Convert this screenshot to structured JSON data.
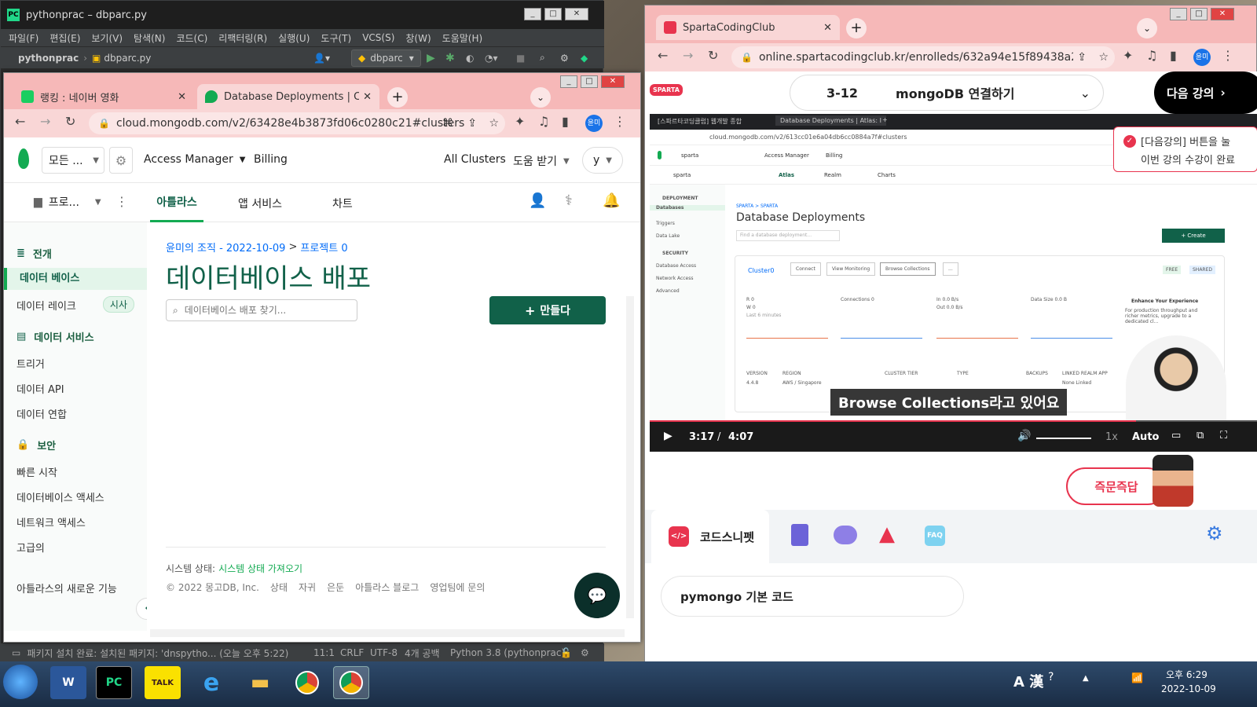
{
  "pycharm": {
    "title": "pythonprac – dbparc.py",
    "menu": [
      "파일(F)",
      "편집(E)",
      "보기(V)",
      "탐색(N)",
      "코드(C)",
      "리팩터링(R)",
      "실행(U)",
      "도구(T)",
      "VCS(S)",
      "창(W)",
      "도움말(H)"
    ],
    "project": "pythonprac",
    "file": "dbparc.py",
    "run_config": "dbparc",
    "status_message": "패키지 설치 완료: 설치된 패키지: 'dnspytho... (오늘 오후 5:22)",
    "status_right": [
      "11:1",
      "CRLF",
      "UTF-8",
      "4개 공백",
      "Python 3.8 (pythonprac)"
    ]
  },
  "chrome_left": {
    "tab1": "랭킹 : 네이버 영화",
    "tab2": "Database Deployments | Cloud",
    "url": "cloud.mongodb.com/v2/63428e4b3873fd06c0280c21#clusters",
    "profile": "윤미"
  },
  "atlas": {
    "org": "모든 ...",
    "access_manager": "Access Manager",
    "billing": "Billing",
    "all_clusters": "All Clusters",
    "help": "도움 받기",
    "user": "y",
    "project": "프로...",
    "tabs": {
      "atlas": "아틀라스",
      "app_services": "앱 서비스",
      "charts": "차트"
    },
    "side": {
      "deployment": "전개",
      "databases": "데이터 베이스",
      "data_lake": "데이터 레이크",
      "preview": "시사",
      "data_services": "데이터 서비스",
      "triggers": "트리거",
      "data_api": "데이터 API",
      "data_federation": "데이터 연합",
      "security": "보안",
      "quickstart": "빠른 시작",
      "db_access": "데이터베이스 액세스",
      "network_access": "네트워크 액세스",
      "advanced": "고급의",
      "whats_new": "아틀라스의 새로운 기능"
    },
    "breadcrumb_org": "윤미의 조직 - 2022-10-09",
    "breadcrumb_sep": ">",
    "breadcrumb_project": "프로젝트 0",
    "page_title": "데이터베이스 배포",
    "search_placeholder": "데이터베이스 배포 찾기...",
    "create_button": "만들다",
    "system_status_label": "시스템 상태:",
    "system_status_link": "시스템 상태 가져오기",
    "footer_copyright": "© 2022 몽고DB, Inc.",
    "footer_links": [
      "상태",
      "자귀",
      "은둔",
      "아틀라스 블로그",
      "영업팀에 문의"
    ]
  },
  "chrome_right": {
    "tab": "SpartaCodingClub",
    "url": "online.spartacodingclub.kr/enrolleds/632a94e15f89438a2ca...",
    "profile": "윤미"
  },
  "sparta": {
    "logo": "SPARTA",
    "lesson_number": "3-12",
    "lesson_title": "mongoDB 연결하기",
    "next_button": "다음 강의",
    "toast_line1": "[다음강의] 버튼을 눌",
    "toast_line2": "이번 강의 수강이 완료",
    "quick_answer": "즉문즉답",
    "code_snippet_tab": "코드스니펫",
    "faq": "FAQ",
    "snippet_title": "pymongo 기본 코드"
  },
  "video": {
    "subtitle": "Browse Collections라고 있어요",
    "time_current": "3:17",
    "time_sep": "/",
    "time_total": "4:07",
    "speed": "1x",
    "quality": "Auto",
    "progress": 0.8,
    "inner": {
      "tab1": "[스파르타코딩클럽] 웹개발 종합",
      "tab2": "Database Deployments | Atlas: I",
      "url": "cloud.mongodb.com/v2/613cc01e6a04db6cc0884a7f#clusters",
      "org": "sparta",
      "access_manager": "Access Manager",
      "billing": "Billing",
      "project": "sparta",
      "tabs": [
        "Atlas",
        "Realm",
        "Charts"
      ],
      "side": [
        "DEPLOYMENT",
        "Databases",
        "Triggers",
        "Data Lake",
        "SECURITY",
        "Database Access",
        "Network Access",
        "Advanced"
      ],
      "breadcrumb": "SPARTA > SPARTA",
      "title": "Database Deployments",
      "search": "Find a database deployment...",
      "create": "+ Create",
      "cluster": "Cluster0",
      "buttons": [
        "Connect",
        "View Monitoring",
        "Browse Collections",
        "..."
      ],
      "badges": [
        "FREE",
        "SHARED"
      ],
      "metric1": "R  0",
      "metric1b": "W  0",
      "metric2": "Connections  0",
      "metric3": "In  0.0 B/s",
      "metric3b": "Out  0.0 B/s",
      "metric4": "Data Size  0.0 B",
      "last6": "Last 6 minutes",
      "enhance_title": "Enhance Your Experience",
      "enhance_body": "For production throughput and richer metrics, upgrade to a dedicated cl...",
      "footer_labels": [
        "VERSION",
        "REGION",
        "CLUSTER TIER",
        "TYPE",
        "BACKUPS",
        "LINKED REALM APP"
      ],
      "footer_values": [
        "4.4.8",
        "AWS / Singapore",
        "None Linked"
      ]
    }
  },
  "taskbar": {
    "time": "오후 6:29",
    "date": "2022-10-09",
    "ime": "A 漢"
  }
}
